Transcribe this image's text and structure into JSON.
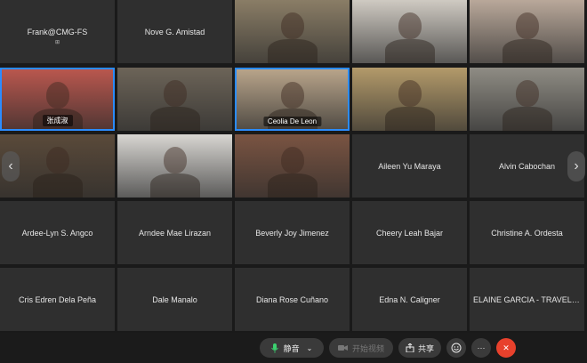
{
  "tiles": [
    {
      "row": 0,
      "col": 0,
      "type": "name",
      "name": "Frank@CMG-FS",
      "sub": "⊞"
    },
    {
      "row": 0,
      "col": 1,
      "type": "name",
      "name": "Nove G. Amistad"
    },
    {
      "row": 0,
      "col": 2,
      "type": "video",
      "bg": "#8a7d66"
    },
    {
      "row": 0,
      "col": 3,
      "type": "video",
      "bg": "#cfcac2"
    },
    {
      "row": 0,
      "col": 4,
      "type": "video",
      "bg": "#b9a89a"
    },
    {
      "row": 1,
      "col": 0,
      "type": "video",
      "bg": "#b9574e",
      "label": "张成淑",
      "active": true
    },
    {
      "row": 1,
      "col": 1,
      "type": "video",
      "bg": "#6c6458"
    },
    {
      "row": 1,
      "col": 2,
      "type": "video",
      "bg": "#b8a48a",
      "label": "Ceolia De Leon",
      "active": true
    },
    {
      "row": 1,
      "col": 3,
      "type": "video",
      "bg": "#b39a6a"
    },
    {
      "row": 1,
      "col": 4,
      "type": "video",
      "bg": "#8f8c84"
    },
    {
      "row": 2,
      "col": 0,
      "type": "video",
      "bg": "#5a4a3a"
    },
    {
      "row": 2,
      "col": 1,
      "type": "video",
      "bg": "#d8d6d2"
    },
    {
      "row": 2,
      "col": 2,
      "type": "video",
      "bg": "#7a5442"
    },
    {
      "row": 2,
      "col": 3,
      "type": "name",
      "name": "Aileen Yu Maraya"
    },
    {
      "row": 2,
      "col": 4,
      "type": "name",
      "name": "Alvin Cabochan"
    },
    {
      "row": 3,
      "col": 0,
      "type": "name",
      "name": "Ardee-Lyn S. Angco"
    },
    {
      "row": 3,
      "col": 1,
      "type": "name",
      "name": "Arndee Mae Lirazan"
    },
    {
      "row": 3,
      "col": 2,
      "type": "name",
      "name": "Beverly Joy Jimenez"
    },
    {
      "row": 3,
      "col": 3,
      "type": "name",
      "name": "Cheery Leah Bajar"
    },
    {
      "row": 3,
      "col": 4,
      "type": "name",
      "name": "Christine A. Ordesta"
    },
    {
      "row": 4,
      "col": 0,
      "type": "name",
      "name": "Cris Edren Dela Peña"
    },
    {
      "row": 4,
      "col": 1,
      "type": "name",
      "name": "Dale Manalo"
    },
    {
      "row": 4,
      "col": 2,
      "type": "name",
      "name": "Diana Rose Cuñano"
    },
    {
      "row": 4,
      "col": 3,
      "type": "name",
      "name": "Edna N. Caligner"
    },
    {
      "row": 4,
      "col": 4,
      "type": "name",
      "name": "ELAINE GARCIA - TRAVELAN..."
    }
  ],
  "nav": {
    "prev": "‹",
    "next": "›"
  },
  "toolbar": {
    "mute_label": "静音",
    "video_label": "开始视频",
    "share_label": "共享",
    "more_label": "···",
    "end_label": "✕"
  }
}
